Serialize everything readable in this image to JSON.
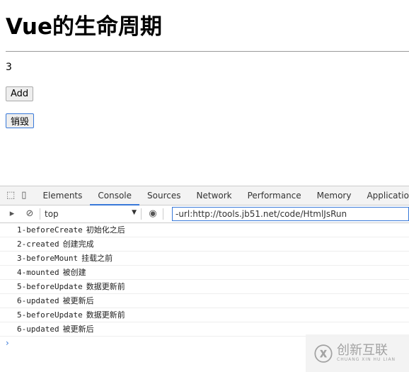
{
  "page": {
    "title": "Vue的生命周期",
    "count": "3",
    "add_label": "Add",
    "destroy_label": "销毁"
  },
  "devtools": {
    "tabs": [
      "Elements",
      "Console",
      "Sources",
      "Network",
      "Performance",
      "Memory",
      "Application"
    ],
    "active_tab": "Console",
    "context": "top",
    "filter_value": "-url:http://tools.jb51.net/code/HtmlJsRun",
    "logs": [
      [
        "1-beforeCreate",
        "初始化之后"
      ],
      [
        "2-created",
        "创建完成"
      ],
      [
        "3-beforeMount",
        "挂载之前"
      ],
      [
        "4-mounted",
        "被创建"
      ],
      [
        "5-beforeUpdate",
        "数据更新前"
      ],
      [
        "6-updated",
        "被更新后"
      ],
      [
        "5-beforeUpdate",
        "数据更新前"
      ],
      [
        "6-updated",
        "被更新后"
      ]
    ],
    "prompt": "›"
  },
  "watermark": {
    "name": "创新互联",
    "pinyin": "CHUANG XIN HU LIAN"
  },
  "colors": {
    "accent": "#3879d9"
  }
}
